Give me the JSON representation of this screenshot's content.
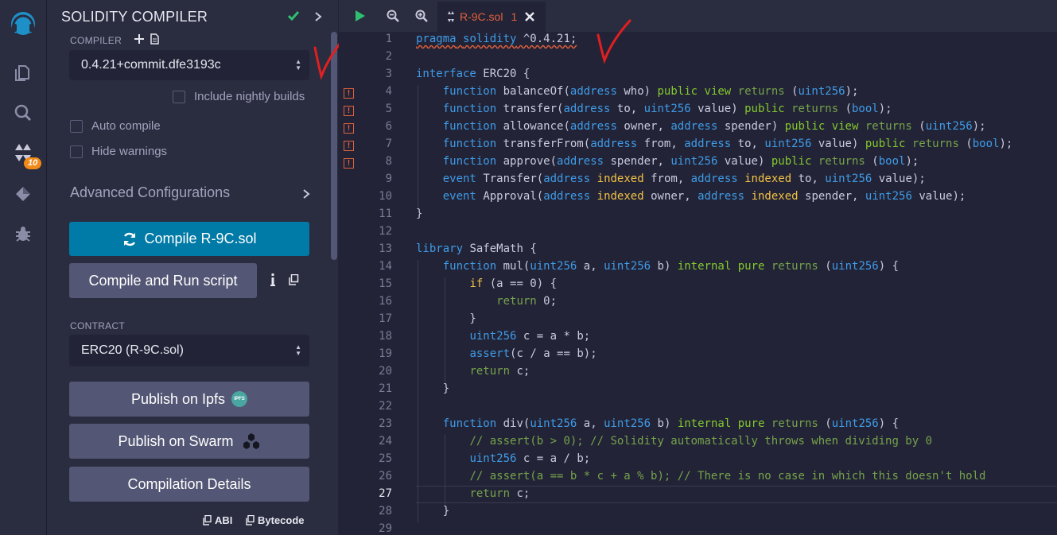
{
  "icon_panel": {
    "badge_count": "10",
    "icons": [
      "remix-logo-icon",
      "file-explorer-icon",
      "search-icon",
      "solidity-compiler-icon",
      "deploy-run-icon",
      "debugger-icon"
    ]
  },
  "compiler_panel": {
    "title": "SOLIDITY COMPILER",
    "compiler_label": "COMPILER",
    "compiler_version": "0.4.21+commit.dfe3193c",
    "include_nightly": "Include nightly builds",
    "auto_compile": "Auto compile",
    "hide_warnings": "Hide warnings",
    "advanced": "Advanced Configurations",
    "compile_button": "Compile R-9C.sol",
    "compile_run_button": "Compile and Run script",
    "contract_label": "CONTRACT",
    "contract_value": "ERC20 (R-9C.sol)",
    "publish_ipfs": "Publish on Ipfs",
    "ipfs_badge": "IPFS",
    "publish_swarm": "Publish on Swarm",
    "compilation_details": "Compilation Details",
    "abi": "ABI",
    "bytecode": "Bytecode"
  },
  "editor": {
    "tab_name": "R-9C.sol",
    "tab_count": "1",
    "active_line": 27,
    "warning_lines": [
      4,
      5,
      6,
      7,
      8
    ],
    "warning_glyph": "!",
    "lines": [
      "pragma solidity ^0.4.21;",
      "",
      "interface ERC20 {",
      "    function balanceOf(address who) public view returns (uint256);",
      "    function transfer(address to, uint256 value) public returns (bool);",
      "    function allowance(address owner, address spender) public view returns (uint256);",
      "    function transferFrom(address from, address to, uint256 value) public returns (bool);",
      "    function approve(address spender, uint256 value) public returns (bool);",
      "    event Transfer(address indexed from, address indexed to, uint256 value);",
      "    event Approval(address indexed owner, address indexed spender, uint256 value);",
      "}",
      "",
      "library SafeMath {",
      "    function mul(uint256 a, uint256 b) internal pure returns (uint256) {",
      "        if (a == 0) {",
      "            return 0;",
      "        }",
      "        uint256 c = a * b;",
      "        assert(c / a == b);",
      "        return c;",
      "    }",
      "",
      "    function div(uint256 a, uint256 b) internal pure returns (uint256) {",
      "        // assert(b > 0); // Solidity automatically throws when dividing by 0",
      "        uint256 c = a / b;",
      "        // assert(a == b * c + a % b); // There is no case in which this doesn't hold",
      "        return c;",
      "    }",
      ""
    ]
  }
}
